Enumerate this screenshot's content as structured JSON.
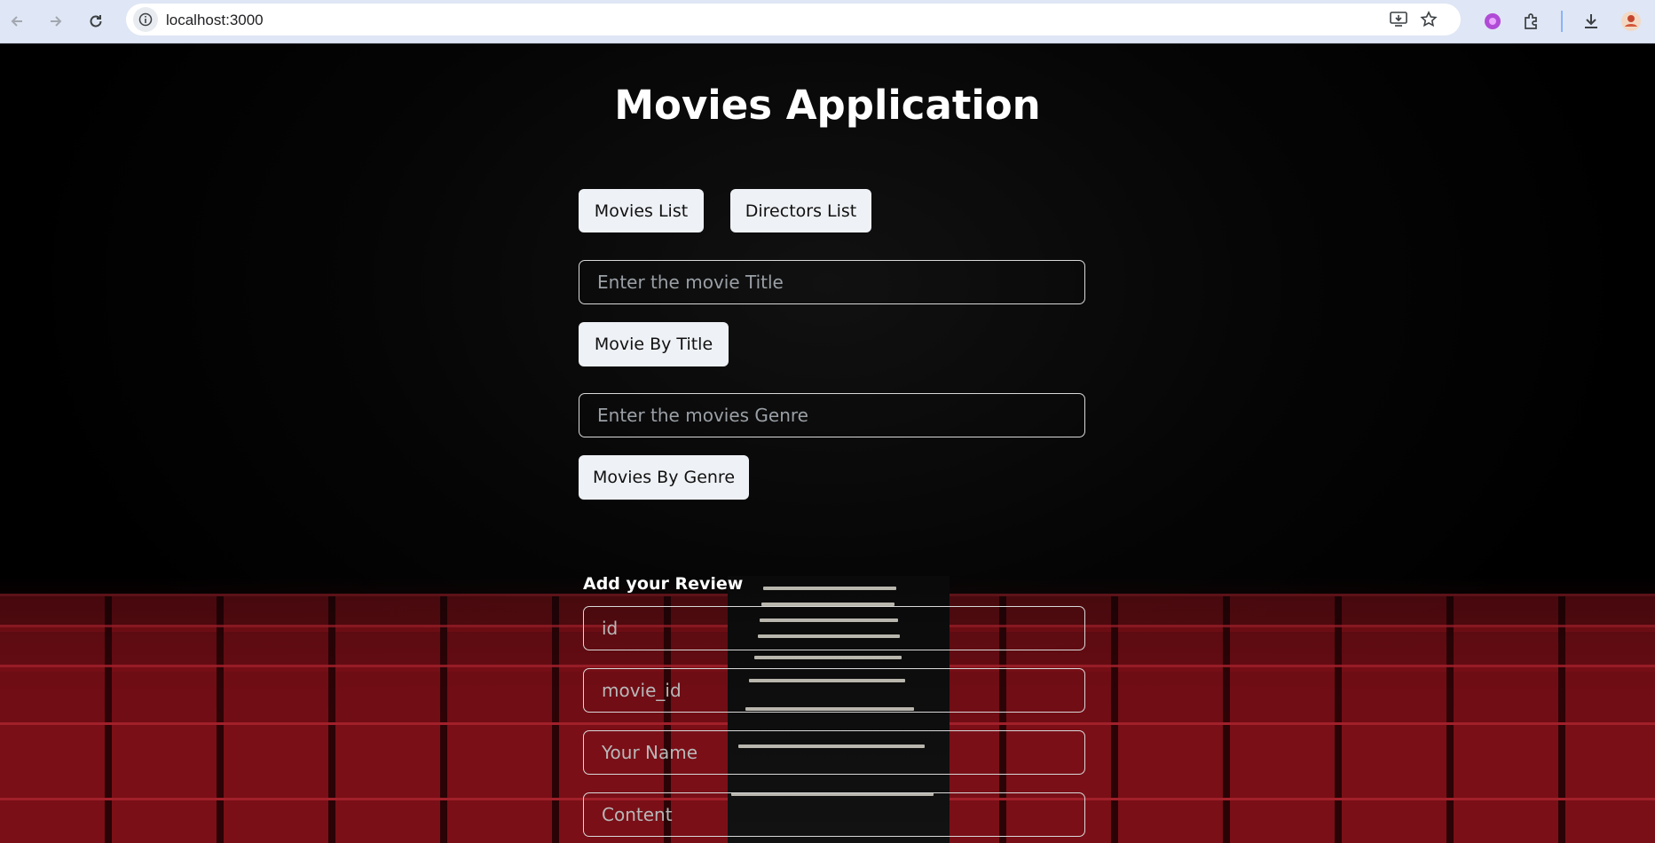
{
  "browser": {
    "url": "localhost:3000"
  },
  "app": {
    "title": "Movies Application",
    "buttons": {
      "movies_list": "Movies List",
      "directors_list": "Directors List",
      "movie_by_title": "Movie By Title",
      "movies_by_genre": "Movies By Genre"
    },
    "inputs": {
      "title_placeholder": "Enter the movie Title",
      "genre_placeholder": "Enter the movies Genre"
    },
    "review": {
      "heading": "Add your Review",
      "id_placeholder": "id",
      "movie_id_placeholder": "movie_id",
      "name_placeholder": "Your Name",
      "content_placeholder": "Content"
    }
  },
  "colors": {
    "background": "#000000",
    "button_bg": "#eef1f5",
    "seat_red": "#7a0f17"
  }
}
